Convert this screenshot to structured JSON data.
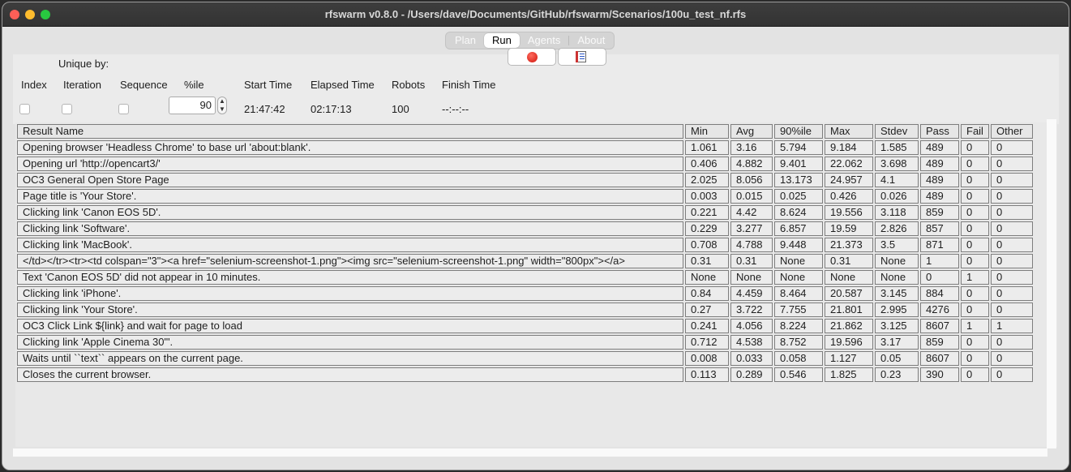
{
  "window": {
    "title": "rfswarm v0.8.0 - /Users/dave/Documents/GitHub/rfswarm/Scenarios/100u_test_nf.rfs"
  },
  "tabs": [
    {
      "label": "Plan"
    },
    {
      "label": "Run"
    },
    {
      "label": "Agents"
    },
    {
      "label": "About"
    }
  ],
  "controls": {
    "unique_by_label": "Unique by:",
    "index_label": "Index",
    "iteration_label": "Iteration",
    "sequence_label": "Sequence",
    "percentile_label": "%ile",
    "percentile_value": "90",
    "start_time_label": "Start Time",
    "start_time_value": "21:47:42",
    "elapsed_time_label": "Elapsed Time",
    "elapsed_time_value": "02:17:13",
    "robots_label": "Robots",
    "robots_value": "100",
    "finish_time_label": "Finish Time",
    "finish_time_value": "--:--:--",
    "stop_icon": "stop-icon",
    "report_icon": "report-icon"
  },
  "results": {
    "headers": [
      "Result Name",
      "Min",
      "Avg",
      "90%ile",
      "Max",
      "Stdev",
      "Pass",
      "Fail",
      "Other"
    ],
    "rows": [
      [
        "Opening browser 'Headless Chrome' to base url 'about:blank'.",
        "1.061",
        "3.16",
        "5.794",
        "9.184",
        "1.585",
        "489",
        "0",
        "0"
      ],
      [
        "Opening url 'http://opencart3/'",
        "0.406",
        "4.882",
        "9.401",
        "22.062",
        "3.698",
        "489",
        "0",
        "0"
      ],
      [
        "OC3 General Open Store Page",
        "2.025",
        "8.056",
        "13.173",
        "24.957",
        "4.1",
        "489",
        "0",
        "0"
      ],
      [
        "Page title is 'Your Store'.",
        "0.003",
        "0.015",
        "0.025",
        "0.426",
        "0.026",
        "489",
        "0",
        "0"
      ],
      [
        "Clicking link 'Canon EOS 5D'.",
        "0.221",
        "4.42",
        "8.624",
        "19.556",
        "3.118",
        "859",
        "0",
        "0"
      ],
      [
        "Clicking link 'Software'.",
        "0.229",
        "3.277",
        "6.857",
        "19.59",
        "2.826",
        "857",
        "0",
        "0"
      ],
      [
        "Clicking link 'MacBook'.",
        "0.708",
        "4.788",
        "9.448",
        "21.373",
        "3.5",
        "871",
        "0",
        "0"
      ],
      [
        "</td></tr><tr><td colspan=\"3\"><a href=\"selenium-screenshot-1.png\"><img src=\"selenium-screenshot-1.png\" width=\"800px\"></a>",
        "0.31",
        "0.31",
        "None",
        "0.31",
        "None",
        "1",
        "0",
        "0"
      ],
      [
        "Text 'Canon EOS 5D' did not appear in 10 minutes.",
        "None",
        "None",
        "None",
        "None",
        "None",
        "0",
        "1",
        "0"
      ],
      [
        "Clicking link 'iPhone'.",
        "0.84",
        "4.459",
        "8.464",
        "20.587",
        "3.145",
        "884",
        "0",
        "0"
      ],
      [
        "Clicking link 'Your Store'.",
        "0.27",
        "3.722",
        "7.755",
        "21.801",
        "2.995",
        "4276",
        "0",
        "0"
      ],
      [
        "OC3 Click Link ${link} and wait for page to load",
        "0.241",
        "4.056",
        "8.224",
        "21.862",
        "3.125",
        "8607",
        "1",
        "1"
      ],
      [
        "Clicking link 'Apple Cinema 30\"'.",
        "0.712",
        "4.538",
        "8.752",
        "19.596",
        "3.17",
        "859",
        "0",
        "0"
      ],
      [
        "Waits until ``text`` appears on the current page.",
        "0.008",
        "0.033",
        "0.058",
        "1.127",
        "0.05",
        "8607",
        "0",
        "0"
      ],
      [
        "Closes the current browser.",
        "0.113",
        "0.289",
        "0.546",
        "1.825",
        "0.23",
        "390",
        "0",
        "0"
      ]
    ]
  }
}
